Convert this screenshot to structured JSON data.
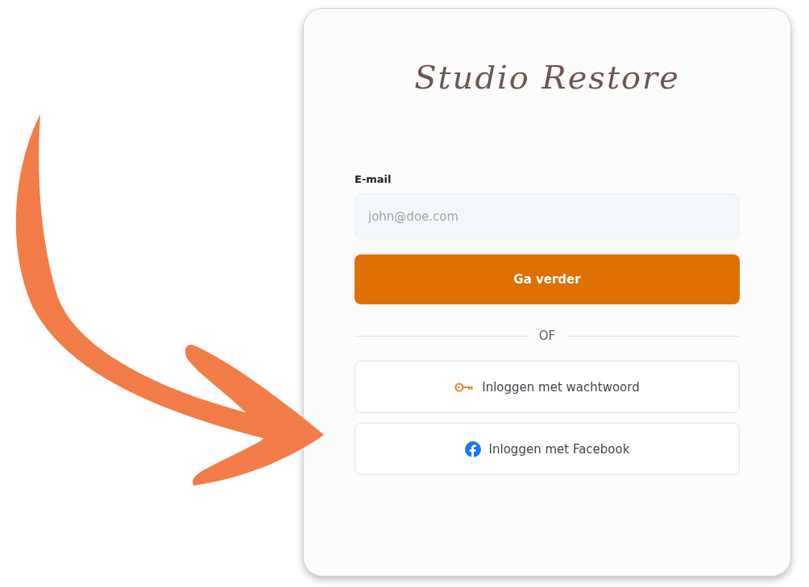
{
  "logo": {
    "text": "Studio Restore"
  },
  "email": {
    "label": "E-mail",
    "placeholder": "john@doe.com"
  },
  "continue_button": {
    "label": "Ga verder"
  },
  "divider": {
    "label": "OF"
  },
  "login_options": [
    {
      "kind": "password",
      "label": "Inloggen met wachtwoord"
    },
    {
      "kind": "facebook",
      "label": "Inloggen met Facebook"
    }
  ]
}
